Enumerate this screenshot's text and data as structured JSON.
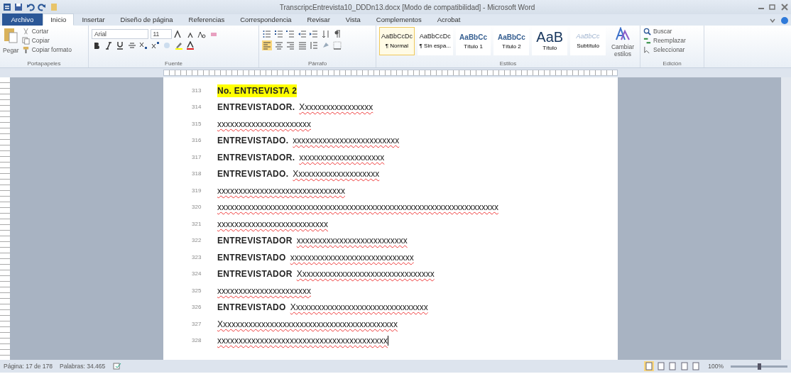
{
  "window": {
    "title": "TranscripcEntrevista10_DDDn13.docx [Modo de compatibilidad] - Microsoft Word"
  },
  "ribbon_tabs": [
    {
      "label": "Archivo",
      "kind": "file",
      "selected": false
    },
    {
      "label": "Inicio",
      "kind": "tab",
      "selected": true
    },
    {
      "label": "Insertar",
      "kind": "tab",
      "selected": false
    },
    {
      "label": "Diseño de página",
      "kind": "tab",
      "selected": false
    },
    {
      "label": "Referencias",
      "kind": "tab",
      "selected": false
    },
    {
      "label": "Correspondencia",
      "kind": "tab",
      "selected": false
    },
    {
      "label": "Revisar",
      "kind": "tab",
      "selected": false
    },
    {
      "label": "Vista",
      "kind": "tab",
      "selected": false
    },
    {
      "label": "Complementos",
      "kind": "tab",
      "selected": false
    },
    {
      "label": "Acrobat",
      "kind": "tab",
      "selected": false
    }
  ],
  "clipboard": {
    "paste": "Pegar",
    "cut": "Cortar",
    "copy": "Copiar",
    "format_painter": "Copiar formato",
    "group": "Portapapeles"
  },
  "font": {
    "name": "Arial",
    "size": "11",
    "group": "Fuente"
  },
  "paragraph": {
    "group": "Párrafo"
  },
  "styles": {
    "group": "Estilos",
    "items": [
      {
        "sample": "AaBbCcDc",
        "label": "¶ Normal",
        "selected": true,
        "kind": "plain"
      },
      {
        "sample": "AaBbCcDc",
        "label": "¶ Sin espa...",
        "selected": false,
        "kind": "plain"
      },
      {
        "sample": "AaBbCc",
        "label": "Título 1",
        "selected": false,
        "kind": "heading"
      },
      {
        "sample": "AaBbCc",
        "label": "Título 2",
        "selected": false,
        "kind": "heading"
      },
      {
        "sample": "AaB",
        "label": "Título",
        "selected": false,
        "kind": "title"
      },
      {
        "sample": "AaBbCc",
        "label": "Subtítulo",
        "selected": false,
        "kind": "subtle"
      }
    ],
    "change": "Cambiar estilos"
  },
  "editing": {
    "group": "Edición",
    "find": "Buscar",
    "replace": "Reemplazar",
    "select": "Seleccionar"
  },
  "document": {
    "lines": [
      {
        "number": "313",
        "kind": "heading",
        "text": "No. ENTREVISTA 2"
      },
      {
        "number": "314",
        "kind": "speech",
        "speaker": "ENTREVISTADOR.",
        "text": "Xxxxxxxxxxxxxxxxx"
      },
      {
        "number": "315",
        "kind": "text",
        "text": "xxxxxxxxxxxxxxxxxxxxxx"
      },
      {
        "number": "316",
        "kind": "speech",
        "speaker": "ENTREVISTADO.",
        "text": "xxxxxxxxxxxxxxxxxxxxxxxxx"
      },
      {
        "number": "317",
        "kind": "speech",
        "speaker": "ENTREVISTADOR.",
        "text": "xxxxxxxxxxxxxxxxxxxx"
      },
      {
        "number": "318",
        "kind": "speech",
        "speaker": "ENTREVISTADO.",
        "text": "Xxxxxxxxxxxxxxxxxxxx"
      },
      {
        "number": "319",
        "kind": "text",
        "text": "xxxxxxxxxxxxxxxxxxxxxxxxxxxxxx"
      },
      {
        "number": "320",
        "kind": "text",
        "text": "xxxxxxxxxxxxxxxxxxxxxxxxxxxxxxxxxxxxxxxxxxxxxxxxxxxxxxxxxxxxxxxxxx"
      },
      {
        "number": "321",
        "kind": "text",
        "text": "xxxxxxxxxxxxxxxxxxxxxxxxxx"
      },
      {
        "number": "322",
        "kind": "speech",
        "speaker": "ENTREVISTADOR",
        "text": "xxxxxxxxxxxxxxxxxxxxxxxxxx"
      },
      {
        "number": "323",
        "kind": "speech",
        "speaker": "ENTREVISTADO",
        "text": "xxxxxxxxxxxxxxxxxxxxxxxxxxxxx"
      },
      {
        "number": "324",
        "kind": "speech",
        "speaker": "ENTREVISTADOR",
        "text": "Xxxxxxxxxxxxxxxxxxxxxxxxxxxxxxxx"
      },
      {
        "number": "325",
        "kind": "text",
        "text": "xxxxxxxxxxxxxxxxxxxxxx"
      },
      {
        "number": "326",
        "kind": "speech",
        "speaker": "ENTREVISTADO",
        "text": "Xxxxxxxxxxxxxxxxxxxxxxxxxxxxxxxx"
      },
      {
        "number": "327",
        "kind": "text",
        "text": "Xxxxxxxxxxxxxxxxxxxxxxxxxxxxxxxxxxxxxxxxxx"
      },
      {
        "number": "328",
        "kind": "cursor",
        "text": "xxxxxxxxxxxxxxxxxxxxxxxxxxxxxxxxxxxxxxxx"
      }
    ]
  },
  "status_bar": {
    "page": "Página: 17 de 178",
    "words": "Palabras: 34.465",
    "zoom": "100%",
    "zoom_slider": {
      "level": 0.5
    }
  }
}
